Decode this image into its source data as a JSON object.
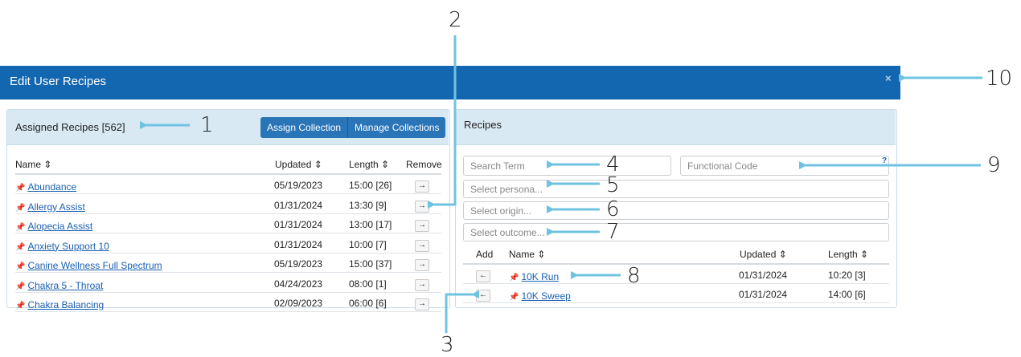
{
  "modal": {
    "title": "Edit User Recipes",
    "close": "×"
  },
  "assigned": {
    "title": "Assigned Recipes [562]",
    "assign_collection": "Assign Collection",
    "manage_collections": "Manage Collections",
    "columns": {
      "name": "Name ⇕",
      "updated": "Updated ⇕",
      "length": "Length ⇕",
      "remove": "Remove"
    },
    "rows": [
      {
        "name": "Abundance",
        "updated": "05/19/2023",
        "length": "15:00 [26]"
      },
      {
        "name": "Allergy Assist",
        "updated": "01/31/2024",
        "length": "13:30 [9]"
      },
      {
        "name": "Alopecia Assist",
        "updated": "01/31/2024",
        "length": "13:00 [17]"
      },
      {
        "name": "Anxiety Support 10",
        "updated": "01/31/2024",
        "length": "10:00 [7]"
      },
      {
        "name": "Canine Wellness Full Spectrum",
        "updated": "05/19/2023",
        "length": "15:00 [37]"
      },
      {
        "name": "Chakra 5 - Throat",
        "updated": "04/24/2023",
        "length": "08:00 [1]"
      },
      {
        "name": "Chakra Balancing",
        "updated": "02/09/2023",
        "length": "06:00 [6]"
      }
    ],
    "remove_glyph": "→"
  },
  "recipes": {
    "title": "Recipes",
    "search_placeholder": "Search Term",
    "functional_code_placeholder": "Functional Code",
    "help": "?",
    "persona_placeholder": "Select persona...",
    "origin_placeholder": "Select origin...",
    "outcome_placeholder": "Select outcome...",
    "columns": {
      "add": "Add",
      "name": "Name ⇕",
      "updated": "Updated ⇕",
      "length": "Length ⇕"
    },
    "rows": [
      {
        "name": "10K Run",
        "updated": "01/31/2024",
        "length": "10:20 [3]"
      },
      {
        "name": "10K Sweep",
        "updated": "01/31/2024",
        "length": "14:00 [6]"
      }
    ],
    "add_glyph": "←"
  },
  "annotations": [
    "1",
    "2",
    "3",
    "4",
    "5",
    "6",
    "7",
    "8",
    "9",
    "10"
  ],
  "colors": {
    "header": "#1366b0",
    "panel_head": "#d9e9f3",
    "button": "#2a74b8",
    "arrow": "#6fc3e0",
    "link": "#1a5fb0"
  }
}
